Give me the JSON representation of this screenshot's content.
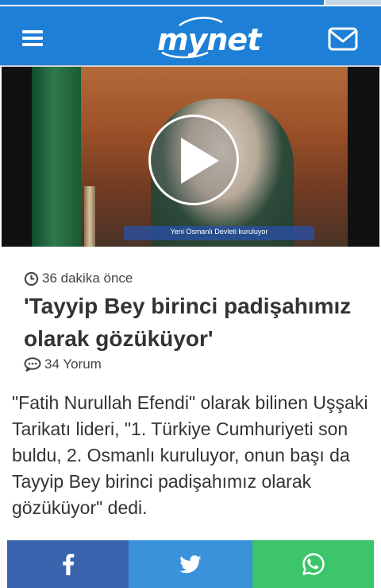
{
  "page_progress": {
    "fraction": 0.85
  },
  "header": {
    "logo_text": "mynet",
    "menu_icon": "hamburger-menu-icon",
    "mail_icon": "mail-icon",
    "background": "#1e7fd6"
  },
  "video": {
    "caption": "Yeni Osmanlı Devleti kuruluyor",
    "play_icon": "play-icon"
  },
  "article": {
    "time_ago": "36 dakika önce",
    "headline": "'Tayyip Bey birinci padişahımız olarak gözüküyor'",
    "comments": "34 Yorum",
    "summary": "\"Fatih Nurullah Efendi\" olarak bilinen Uşşaki Tarikatı lideri, \"1. Türkiye Cumhuriyeti son buldu, 2. Osmanlı kuruluyor, onun başı da Tayyip Bey birinci padişahımız olarak gözüküyor\" dedi."
  },
  "share": {
    "facebook_color": "#3a64ae",
    "twitter_color": "#3a92db",
    "whatsapp_color": "#3cc56a",
    "icons": [
      "facebook-icon",
      "twitter-icon",
      "whatsapp-icon"
    ]
  }
}
